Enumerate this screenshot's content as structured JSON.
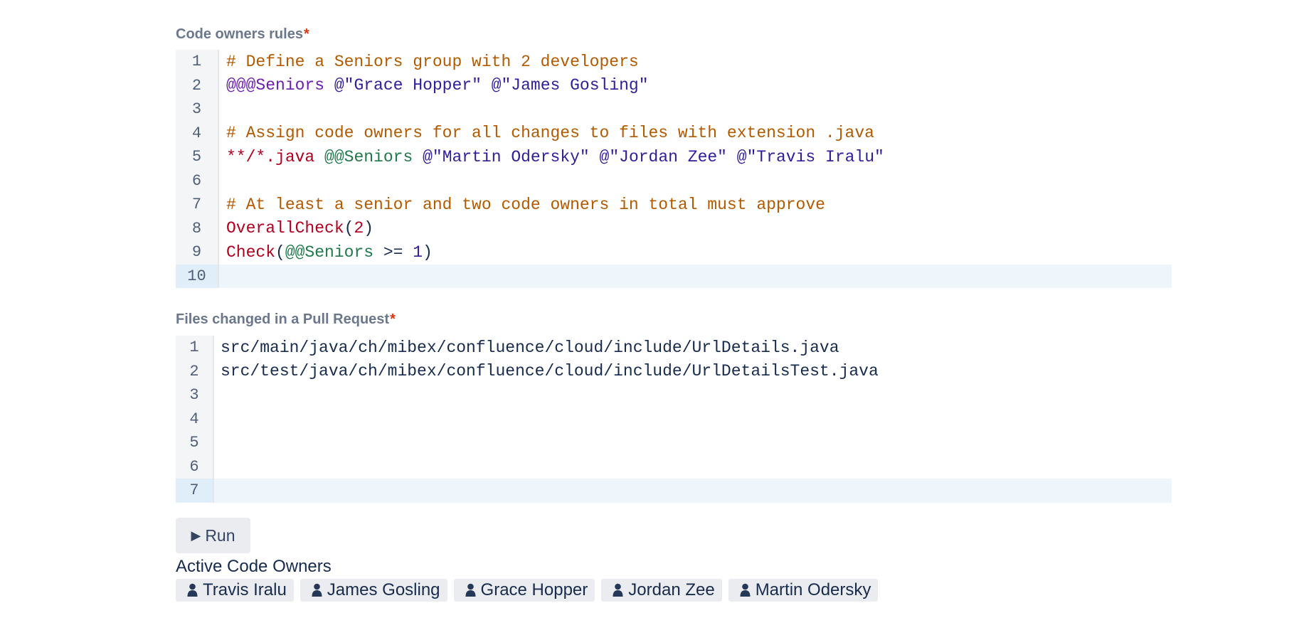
{
  "rules_label": "Code owners rules",
  "files_label": "Files changed in a Pull Request",
  "required_mark": "*",
  "rules_editor": {
    "lines": [
      {
        "n": "1",
        "tokens": [
          {
            "t": "# Define a Seniors group with 2 developers",
            "c": "c-com"
          }
        ]
      },
      {
        "n": "2",
        "tokens": [
          {
            "t": "@@@Seniors",
            "c": "c-grp"
          },
          {
            "t": " ",
            "c": ""
          },
          {
            "t": "@\"Grace Hopper\"",
            "c": "c-usr"
          },
          {
            "t": " ",
            "c": ""
          },
          {
            "t": "@\"James Gosling\"",
            "c": "c-usr"
          }
        ]
      },
      {
        "n": "3",
        "tokens": []
      },
      {
        "n": "4",
        "tokens": [
          {
            "t": "# Assign code owners for all changes to files with extension .java",
            "c": "c-com"
          }
        ]
      },
      {
        "n": "5",
        "tokens": [
          {
            "t": "**/*.java",
            "c": "c-pat"
          },
          {
            "t": " ",
            "c": ""
          },
          {
            "t": "@@Seniors",
            "c": "c-ref"
          },
          {
            "t": " ",
            "c": ""
          },
          {
            "t": "@\"Martin Odersky\"",
            "c": "c-usr"
          },
          {
            "t": " ",
            "c": ""
          },
          {
            "t": "@\"Jordan Zee\"",
            "c": "c-usr"
          },
          {
            "t": " ",
            "c": ""
          },
          {
            "t": "@\"Travis Iralu\"",
            "c": "c-usr"
          }
        ]
      },
      {
        "n": "6",
        "tokens": []
      },
      {
        "n": "7",
        "tokens": [
          {
            "t": "# At least a senior and two code owners in total must approve",
            "c": "c-com"
          }
        ]
      },
      {
        "n": "8",
        "tokens": [
          {
            "t": "OverallCheck",
            "c": "c-fn"
          },
          {
            "t": "(",
            "c": ""
          },
          {
            "t": "2",
            "c": "c-num"
          },
          {
            "t": ")",
            "c": ""
          }
        ]
      },
      {
        "n": "9",
        "tokens": [
          {
            "t": "Check",
            "c": "c-fn"
          },
          {
            "t": "(",
            "c": ""
          },
          {
            "t": "@@Seniors",
            "c": "c-ref"
          },
          {
            "t": " >= ",
            "c": ""
          },
          {
            "t": "1",
            "c": "c-num2"
          },
          {
            "t": ")",
            "c": ""
          }
        ]
      },
      {
        "n": "10",
        "tokens": [],
        "active": true
      }
    ]
  },
  "files_editor": {
    "lines": [
      {
        "n": "1",
        "tokens": [
          {
            "t": "src/main/java/ch/mibex/confluence/cloud/include/UrlDetails.java",
            "c": ""
          }
        ]
      },
      {
        "n": "2",
        "tokens": [
          {
            "t": "src/test/java/ch/mibex/confluence/cloud/include/UrlDetailsTest.java",
            "c": ""
          }
        ]
      },
      {
        "n": "3",
        "tokens": []
      },
      {
        "n": "4",
        "tokens": []
      },
      {
        "n": "5",
        "tokens": []
      },
      {
        "n": "6",
        "tokens": []
      },
      {
        "n": "7",
        "tokens": [],
        "active": true
      }
    ]
  },
  "run_button": {
    "icon": "play-icon",
    "label": "Run"
  },
  "owners_title": "Active Code Owners",
  "owners": [
    "Travis Iralu",
    "James Gosling",
    "Grace Hopper",
    "Jordan Zee",
    "Martin Odersky"
  ],
  "colors": {
    "accent": "#DE350B",
    "active_line": "#EEF6FC",
    "chip_bg": "#EBECF0"
  }
}
